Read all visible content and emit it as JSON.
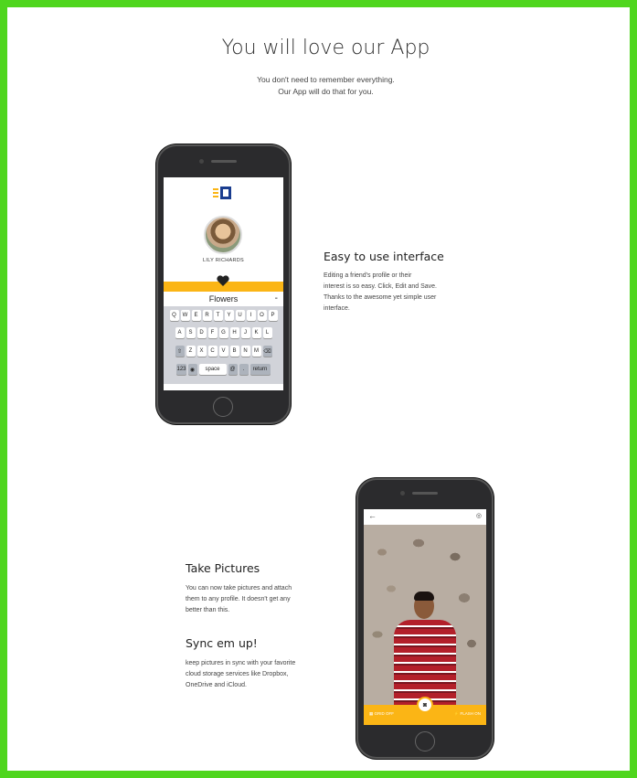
{
  "hero": {
    "title": "You will love our App",
    "subtitle_line1": "You don't need to remember everything.",
    "subtitle_line2": "Our App will do that for you."
  },
  "feature1": {
    "title": "Easy to use interface",
    "body_lines": [
      "Editing a friend's profile or their",
      "interest is so easy. Click, Edit and Save.",
      "Thanks to the awesome yet simple user",
      "interface."
    ]
  },
  "feature2": {
    "title": "Take Pictures",
    "body_lines": [
      "You can now take pictures and attach",
      "them to any profile. It doesn't get any",
      "better than this."
    ]
  },
  "feature3": {
    "title": "Sync em up!",
    "body_lines": [
      "keep pictures in sync with your favorite",
      "cloud storage services like Dropbox,",
      "OneDrive and iCloud."
    ]
  },
  "phone1": {
    "profile_name": "LILY RICHARDS",
    "interest": "Flowers",
    "interest_action": "-",
    "keyboard_row1": [
      "Q",
      "W",
      "E",
      "R",
      "T",
      "Y",
      "U",
      "I",
      "O",
      "P"
    ],
    "keyboard_row2": [
      "A",
      "S",
      "D",
      "F",
      "G",
      "H",
      "J",
      "K",
      "L"
    ],
    "keyboard_row3": [
      "⇧",
      "Z",
      "X",
      "C",
      "V",
      "B",
      "N",
      "M",
      "⌫"
    ],
    "keyboard_row4": [
      "123",
      "◉",
      "space",
      "@",
      ".",
      "return"
    ]
  },
  "phone2": {
    "back": "←",
    "toggle_icon": "◎",
    "grid_label": "▦ GRID OFF",
    "flash_label": "⚡ FLASH ON",
    "shutter_icon": "◙"
  },
  "colors": {
    "frame_border": "#4fd61e",
    "accent_yellow": "#fbb515",
    "logo_blue": "#1a3d8f"
  }
}
